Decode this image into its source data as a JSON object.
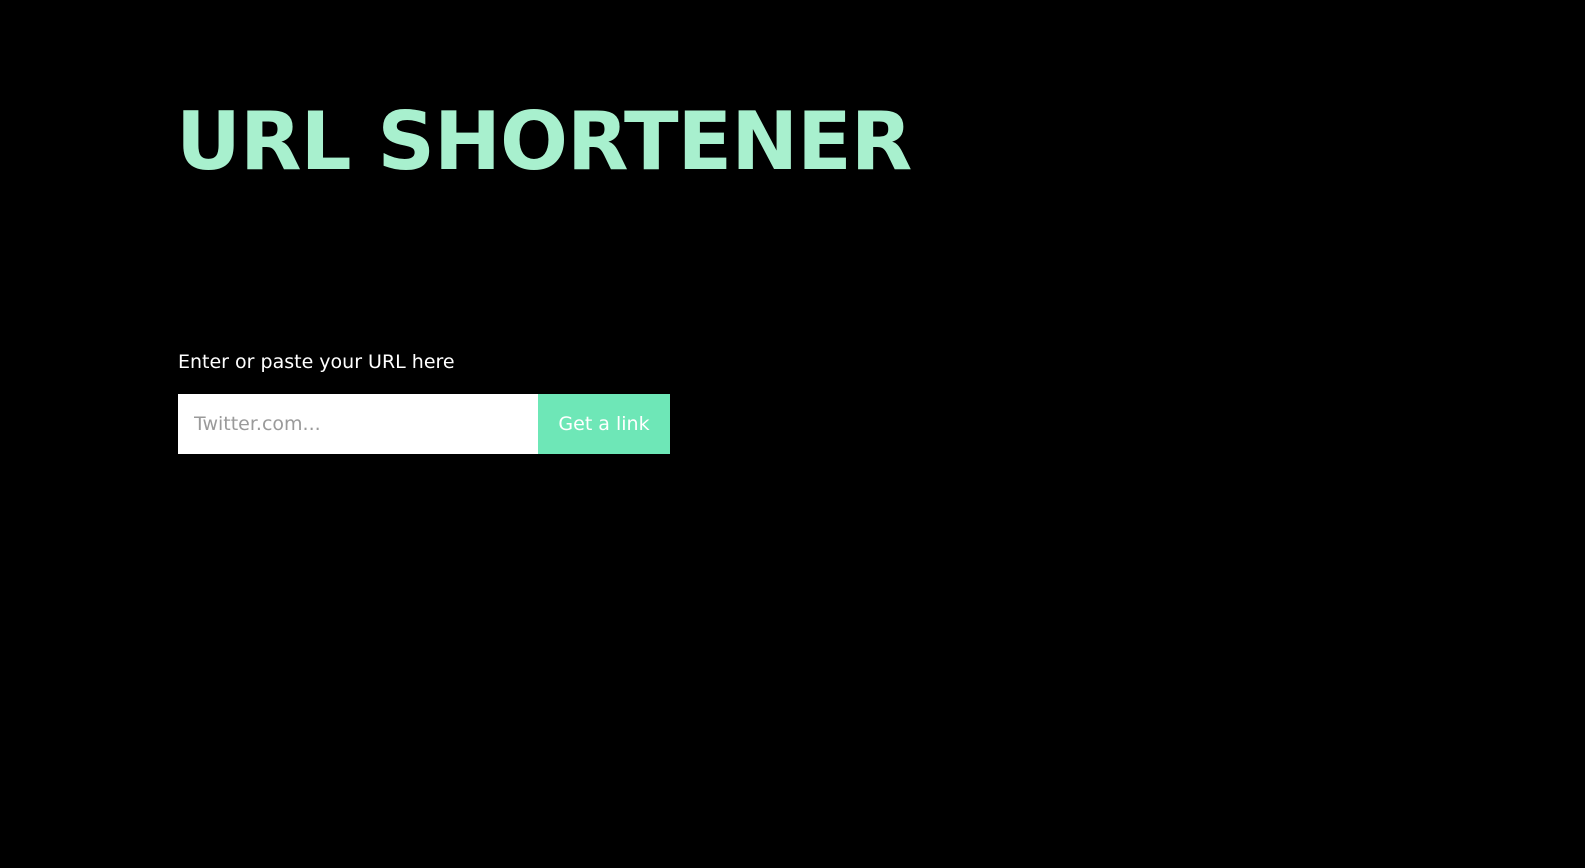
{
  "header": {
    "title": "URL SHORTENER"
  },
  "form": {
    "label": "Enter or paste your URL here",
    "input_value": "",
    "input_placeholder": "Twitter.com...",
    "button_label": "Get a link"
  },
  "colors": {
    "background": "#000000",
    "title": "#a8f0ce",
    "accent": "#6ee7b7",
    "label_text": "#ffffff",
    "input_background": "#ffffff",
    "placeholder": "#9a9a9a",
    "button_text": "#ffffff"
  }
}
